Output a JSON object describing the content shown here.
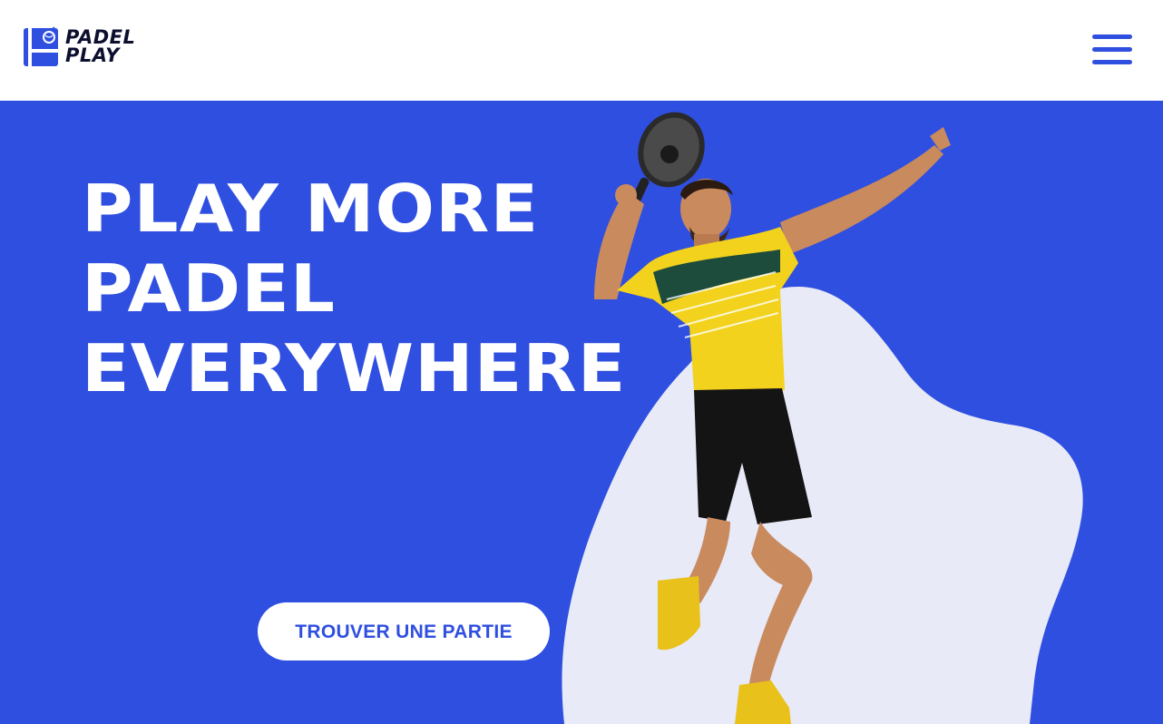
{
  "header": {
    "logo": {
      "line1": "PADEL",
      "line2": "PLAY",
      "icon": "padel-court-ball-icon"
    },
    "menu_icon": "hamburger-menu-icon"
  },
  "hero": {
    "headline": {
      "line1": "PLAY MORE",
      "line2": "PADEL",
      "line3": "EVERYWHERE"
    },
    "cta_label": "TROUVER UNE PARTIE",
    "image": "padel-player-jumping-photo"
  },
  "colors": {
    "primary": "#2f4fe0",
    "blob": "#e8eaf7",
    "white": "#ffffff",
    "logo_text": "#0c0f2e",
    "shirt": "#f2d21c",
    "shorts": "#141414",
    "skin": "#c98a5e"
  }
}
